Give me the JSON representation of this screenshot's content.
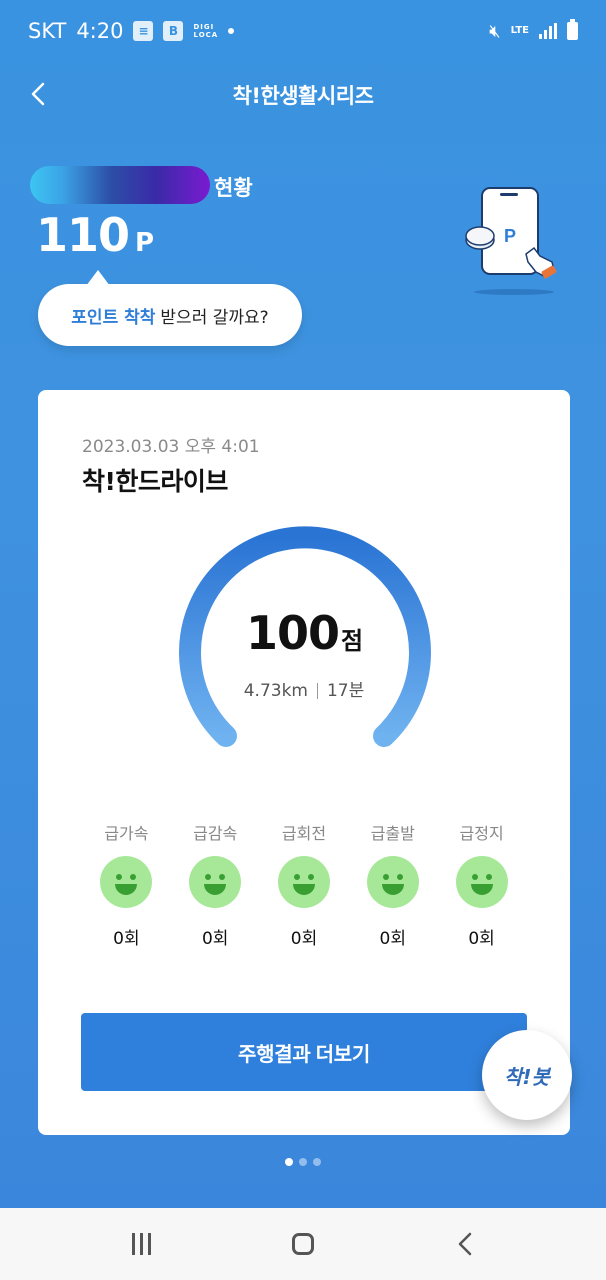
{
  "status_bar": {
    "carrier": "SKT",
    "time": "4:20",
    "app_icon_label": "B",
    "digi_label": "DIGI",
    "loca_label": "LOCA",
    "network": "LTE"
  },
  "header": {
    "title": "착!한생활시리즈"
  },
  "points": {
    "status_label": "현황",
    "value": "110",
    "unit": "P",
    "bubble_highlight": "포인트 착착",
    "bubble_text": "받으러 갈까요?"
  },
  "card": {
    "date": "2023.03.03 오후 4:01",
    "title": "착!한드라이브",
    "score": "100",
    "score_unit": "점",
    "distance": "4.73km",
    "duration": "17분",
    "events": [
      {
        "label": "급가속",
        "count": "0회"
      },
      {
        "label": "급감속",
        "count": "0회"
      },
      {
        "label": "급회전",
        "count": "0회"
      },
      {
        "label": "급출발",
        "count": "0회"
      },
      {
        "label": "급정지",
        "count": "0회"
      }
    ],
    "more_button": "주행결과 더보기"
  },
  "chakbot": {
    "label": "착!봇"
  },
  "pager": {
    "total": 3,
    "active": 1
  },
  "colors": {
    "background": "#3a93e0",
    "primary_button": "#2f80dc",
    "smiley": "#a6e898"
  }
}
